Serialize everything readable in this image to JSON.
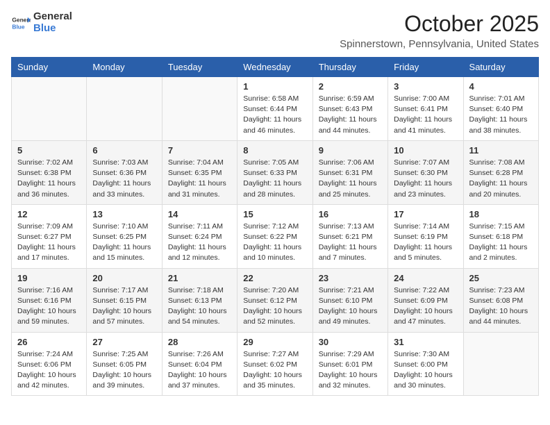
{
  "header": {
    "logo_general": "General",
    "logo_blue": "Blue",
    "month": "October 2025",
    "location": "Spinnerstown, Pennsylvania, United States"
  },
  "days_of_week": [
    "Sunday",
    "Monday",
    "Tuesday",
    "Wednesday",
    "Thursday",
    "Friday",
    "Saturday"
  ],
  "weeks": [
    [
      {
        "day": "",
        "empty": true
      },
      {
        "day": "",
        "empty": true
      },
      {
        "day": "",
        "empty": true
      },
      {
        "day": "1",
        "sunrise": "6:58 AM",
        "sunset": "6:44 PM",
        "daylight": "11 hours and 46 minutes."
      },
      {
        "day": "2",
        "sunrise": "6:59 AM",
        "sunset": "6:43 PM",
        "daylight": "11 hours and 44 minutes."
      },
      {
        "day": "3",
        "sunrise": "7:00 AM",
        "sunset": "6:41 PM",
        "daylight": "11 hours and 41 minutes."
      },
      {
        "day": "4",
        "sunrise": "7:01 AM",
        "sunset": "6:40 PM",
        "daylight": "11 hours and 38 minutes."
      }
    ],
    [
      {
        "day": "5",
        "sunrise": "7:02 AM",
        "sunset": "6:38 PM",
        "daylight": "11 hours and 36 minutes."
      },
      {
        "day": "6",
        "sunrise": "7:03 AM",
        "sunset": "6:36 PM",
        "daylight": "11 hours and 33 minutes."
      },
      {
        "day": "7",
        "sunrise": "7:04 AM",
        "sunset": "6:35 PM",
        "daylight": "11 hours and 31 minutes."
      },
      {
        "day": "8",
        "sunrise": "7:05 AM",
        "sunset": "6:33 PM",
        "daylight": "11 hours and 28 minutes."
      },
      {
        "day": "9",
        "sunrise": "7:06 AM",
        "sunset": "6:31 PM",
        "daylight": "11 hours and 25 minutes."
      },
      {
        "day": "10",
        "sunrise": "7:07 AM",
        "sunset": "6:30 PM",
        "daylight": "11 hours and 23 minutes."
      },
      {
        "day": "11",
        "sunrise": "7:08 AM",
        "sunset": "6:28 PM",
        "daylight": "11 hours and 20 minutes."
      }
    ],
    [
      {
        "day": "12",
        "sunrise": "7:09 AM",
        "sunset": "6:27 PM",
        "daylight": "11 hours and 17 minutes."
      },
      {
        "day": "13",
        "sunrise": "7:10 AM",
        "sunset": "6:25 PM",
        "daylight": "11 hours and 15 minutes."
      },
      {
        "day": "14",
        "sunrise": "7:11 AM",
        "sunset": "6:24 PM",
        "daylight": "11 hours and 12 minutes."
      },
      {
        "day": "15",
        "sunrise": "7:12 AM",
        "sunset": "6:22 PM",
        "daylight": "11 hours and 10 minutes."
      },
      {
        "day": "16",
        "sunrise": "7:13 AM",
        "sunset": "6:21 PM",
        "daylight": "11 hours and 7 minutes."
      },
      {
        "day": "17",
        "sunrise": "7:14 AM",
        "sunset": "6:19 PM",
        "daylight": "11 hours and 5 minutes."
      },
      {
        "day": "18",
        "sunrise": "7:15 AM",
        "sunset": "6:18 PM",
        "daylight": "11 hours and 2 minutes."
      }
    ],
    [
      {
        "day": "19",
        "sunrise": "7:16 AM",
        "sunset": "6:16 PM",
        "daylight": "10 hours and 59 minutes."
      },
      {
        "day": "20",
        "sunrise": "7:17 AM",
        "sunset": "6:15 PM",
        "daylight": "10 hours and 57 minutes."
      },
      {
        "day": "21",
        "sunrise": "7:18 AM",
        "sunset": "6:13 PM",
        "daylight": "10 hours and 54 minutes."
      },
      {
        "day": "22",
        "sunrise": "7:20 AM",
        "sunset": "6:12 PM",
        "daylight": "10 hours and 52 minutes."
      },
      {
        "day": "23",
        "sunrise": "7:21 AM",
        "sunset": "6:10 PM",
        "daylight": "10 hours and 49 minutes."
      },
      {
        "day": "24",
        "sunrise": "7:22 AM",
        "sunset": "6:09 PM",
        "daylight": "10 hours and 47 minutes."
      },
      {
        "day": "25",
        "sunrise": "7:23 AM",
        "sunset": "6:08 PM",
        "daylight": "10 hours and 44 minutes."
      }
    ],
    [
      {
        "day": "26",
        "sunrise": "7:24 AM",
        "sunset": "6:06 PM",
        "daylight": "10 hours and 42 minutes."
      },
      {
        "day": "27",
        "sunrise": "7:25 AM",
        "sunset": "6:05 PM",
        "daylight": "10 hours and 39 minutes."
      },
      {
        "day": "28",
        "sunrise": "7:26 AM",
        "sunset": "6:04 PM",
        "daylight": "10 hours and 37 minutes."
      },
      {
        "day": "29",
        "sunrise": "7:27 AM",
        "sunset": "6:02 PM",
        "daylight": "10 hours and 35 minutes."
      },
      {
        "day": "30",
        "sunrise": "7:29 AM",
        "sunset": "6:01 PM",
        "daylight": "10 hours and 32 minutes."
      },
      {
        "day": "31",
        "sunrise": "7:30 AM",
        "sunset": "6:00 PM",
        "daylight": "10 hours and 30 minutes."
      },
      {
        "day": "",
        "empty": true
      }
    ]
  ]
}
